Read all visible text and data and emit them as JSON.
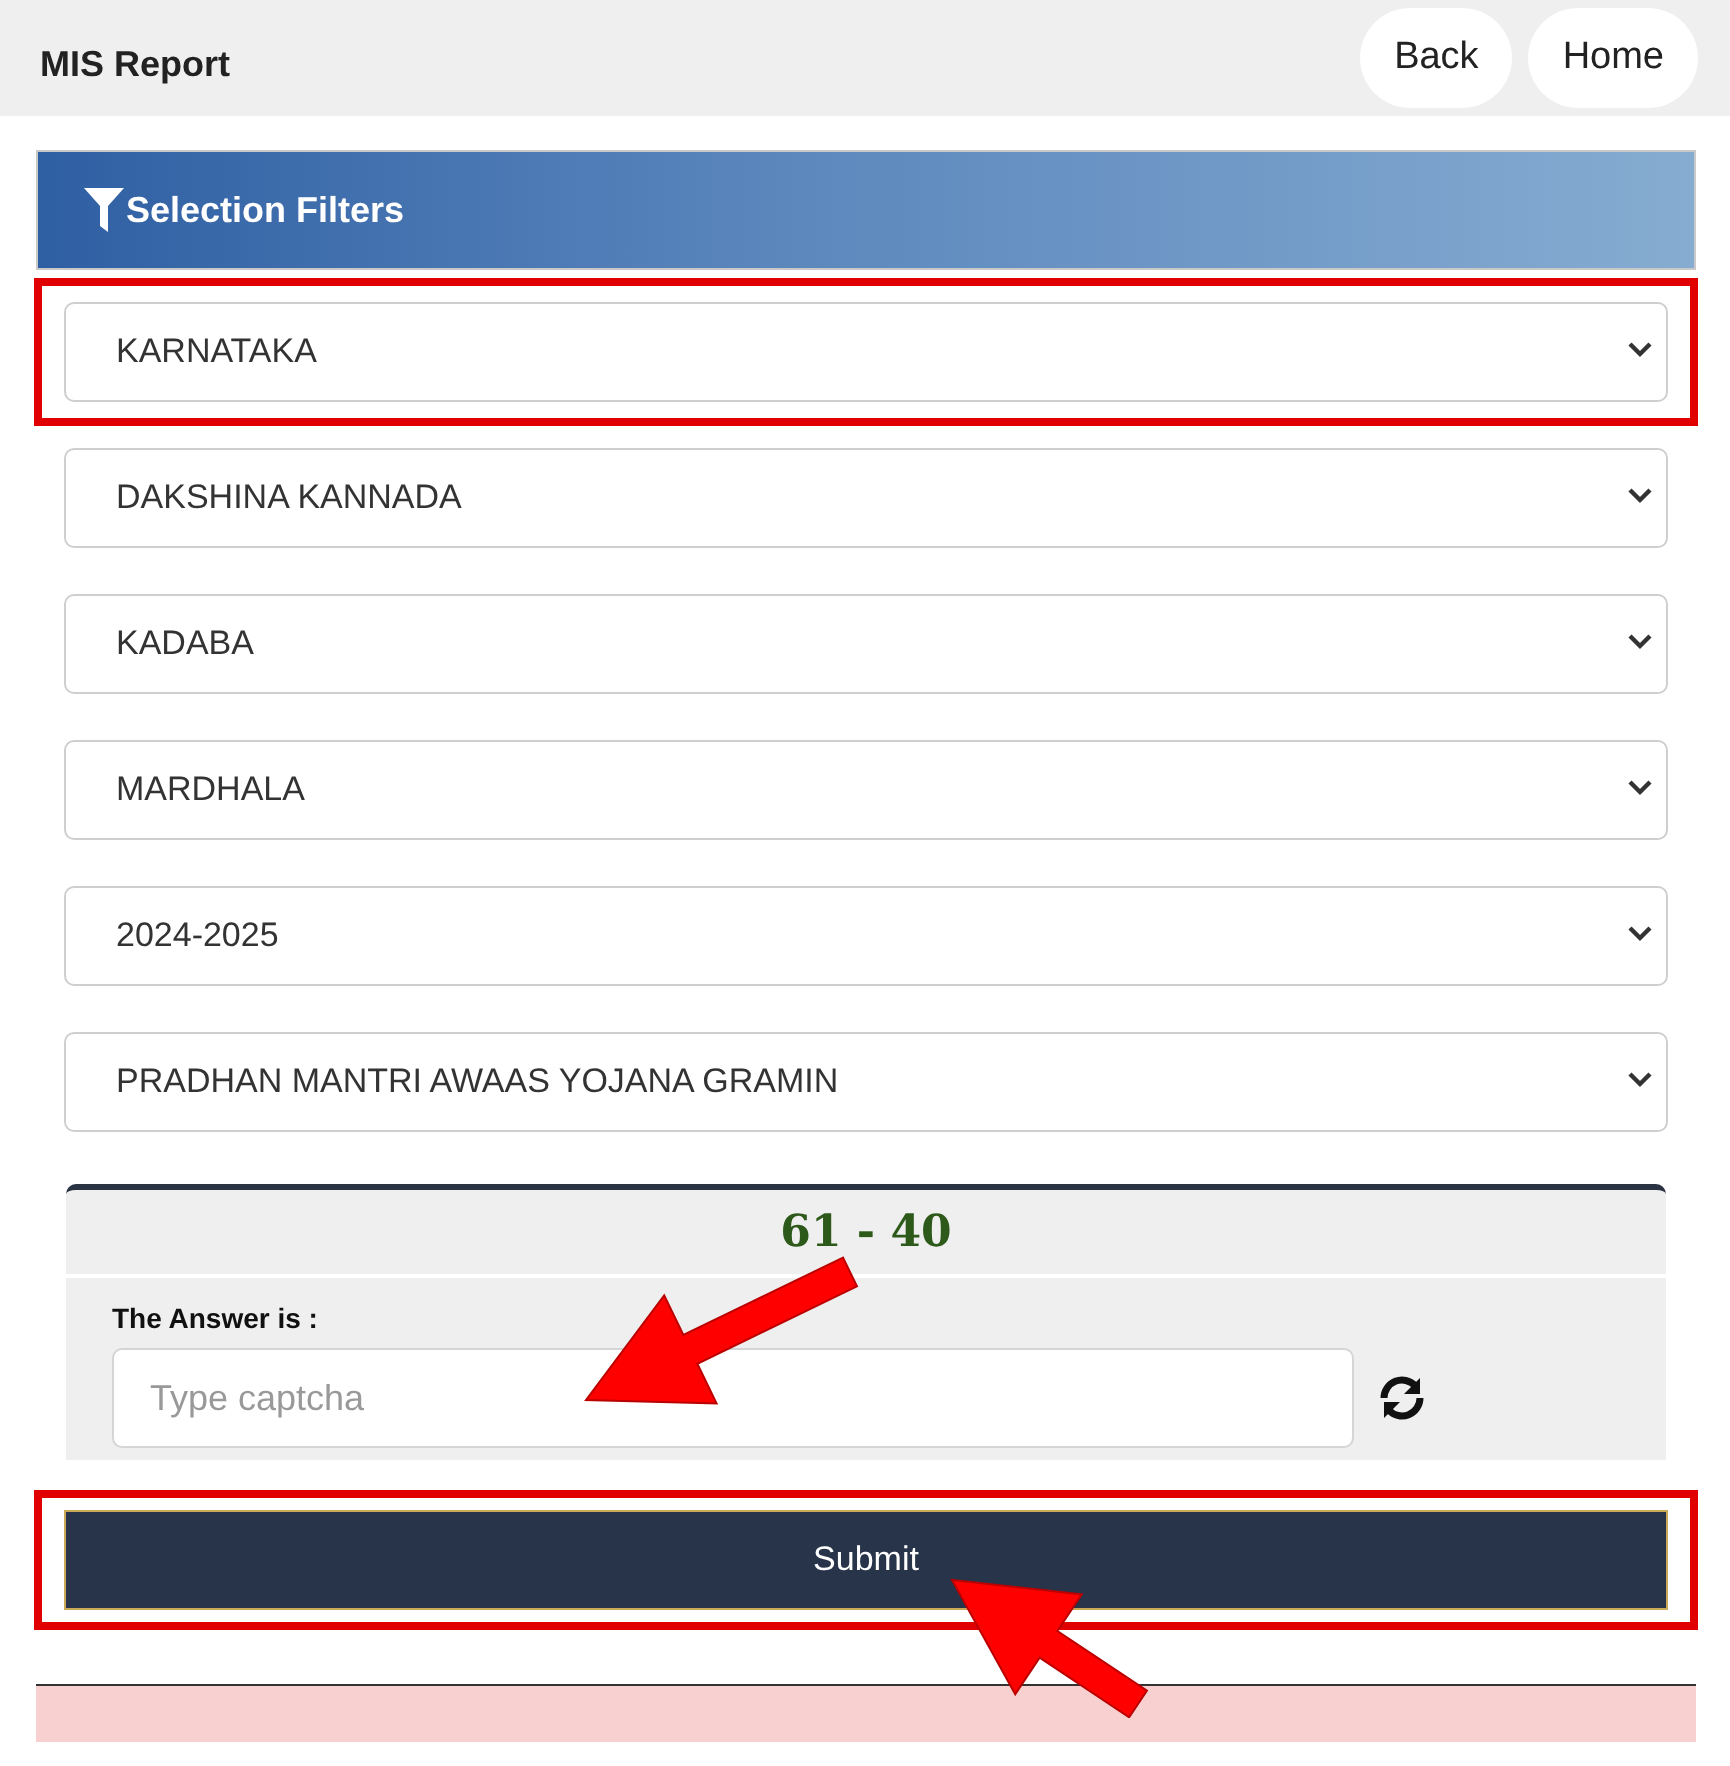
{
  "header": {
    "title": "MIS Report",
    "buttons": [
      "Back",
      "Home"
    ]
  },
  "filters": {
    "title": "Selection Filters",
    "dropdowns": [
      {
        "value": "KARNATAKA",
        "highlighted": true
      },
      {
        "value": "DAKSHINA KANNADA",
        "highlighted": false
      },
      {
        "value": "KADABA",
        "highlighted": false
      },
      {
        "value": "MARDHALA",
        "highlighted": false
      },
      {
        "value": "2024-2025",
        "highlighted": false
      },
      {
        "value": "PRADHAN MANTRI AWAAS YOJANA GRAMIN",
        "highlighted": false
      }
    ]
  },
  "captcha": {
    "question": "61 - 40",
    "label": "The Answer is :",
    "placeholder": "Type captcha"
  },
  "submit": {
    "label": "Submit",
    "highlighted": true
  }
}
